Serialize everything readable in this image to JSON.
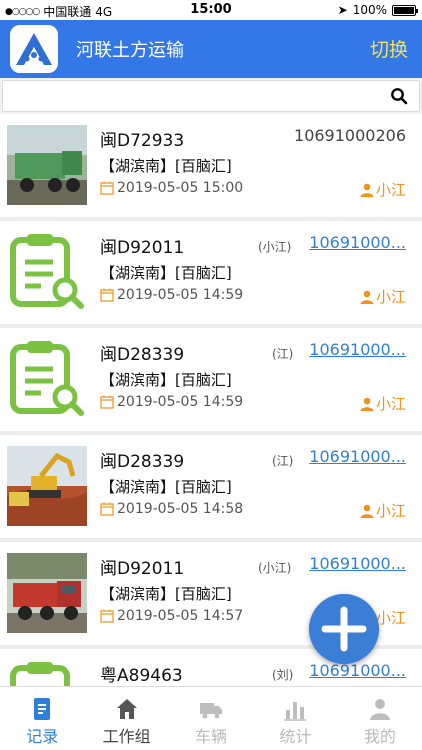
{
  "status_bar": {
    "carrier": "中国联通",
    "network": "4G",
    "time": "15:00",
    "battery": "100%"
  },
  "header": {
    "title": "河联土方运输",
    "switch_label": "切换"
  },
  "search": {
    "placeholder": ""
  },
  "records": [
    {
      "plate": "闽D72933",
      "region": "【湖滨南】[百脑汇]",
      "datetime": "2019-05-05 15:00",
      "phone": "10691000206",
      "person": "",
      "driver": "小江",
      "thumb": "photo-green-truck"
    },
    {
      "plate": "闽D92011",
      "region": "【湖滨南】[百脑汇]",
      "datetime": "2019-05-05 14:59",
      "phone": "10691000...",
      "person": "(小江)",
      "driver": "小江",
      "thumb": "clipboard-icon"
    },
    {
      "plate": "闽D28339",
      "region": "【湖滨南】[百脑汇]",
      "datetime": "2019-05-05 14:59",
      "phone": "10691000...",
      "person": "(江)",
      "driver": "小江",
      "thumb": "clipboard-icon"
    },
    {
      "plate": "闽D28339",
      "region": "【湖滨南】[百脑汇]",
      "datetime": "2019-05-05 14:58",
      "phone": "10691000...",
      "person": "(江)",
      "driver": "小江",
      "thumb": "photo-excavator"
    },
    {
      "plate": "闽D92011",
      "region": "【湖滨南】[百脑汇]",
      "datetime": "2019-05-05 14:57",
      "phone": "10691000...",
      "person": "(小江)",
      "driver": "小江",
      "thumb": "photo-red-truck"
    },
    {
      "plate": "粤A89463",
      "region": "",
      "datetime": "",
      "phone": "10691000...",
      "person": "(刘)",
      "driver": "",
      "thumb": "clipboard-icon"
    }
  ],
  "tabs": [
    {
      "label": "记录",
      "icon": "record-icon",
      "state": "active"
    },
    {
      "label": "工作组",
      "icon": "home-icon",
      "state": "normal"
    },
    {
      "label": "车辆",
      "icon": "truck-icon",
      "state": "disabled"
    },
    {
      "label": "统计",
      "icon": "chart-icon",
      "state": "disabled"
    },
    {
      "label": "我的",
      "icon": "user-icon",
      "state": "disabled"
    }
  ],
  "colors": {
    "header_bg": "#3478e8",
    "switch_text": "#f4e15a",
    "accent_green": "#7cc242",
    "driver_orange": "#f1921b",
    "link_blue": "#2f7fd9",
    "fab_blue": "#3a7ed6"
  }
}
